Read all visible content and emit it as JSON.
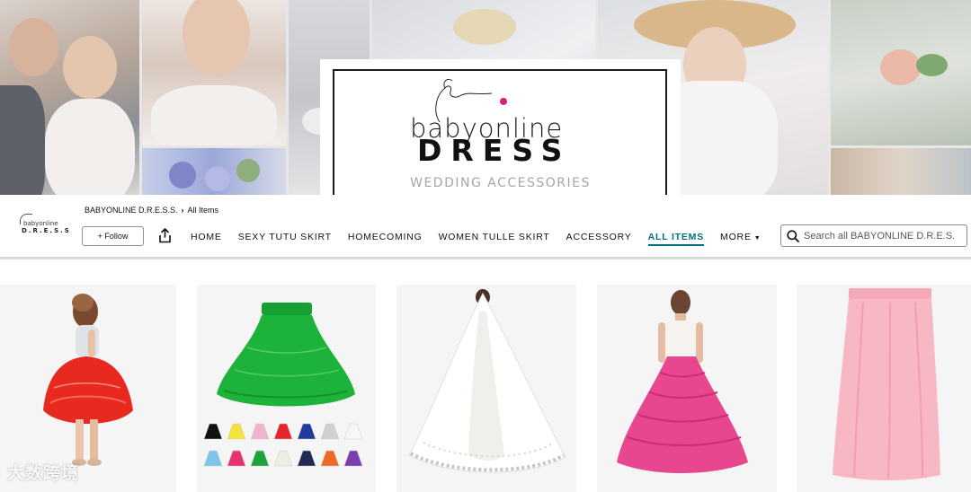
{
  "hero": {
    "brand_line1": "babyonline",
    "brand_line2": "DRESS",
    "tagline": "WEDDING ACCESSORIES"
  },
  "store": {
    "logo_line1": "babyonline",
    "logo_line2": "D.R.E.S.S",
    "breadcrumb": [
      "BABYONLINE D.R.E.S.S.",
      "All Items"
    ],
    "follow_label": "+ Follow",
    "nav": [
      {
        "label": "HOME",
        "active": false
      },
      {
        "label": "SEXY TUTU SKIRT",
        "active": false
      },
      {
        "label": "HOMECOMING",
        "active": false
      },
      {
        "label": "WOMEN TULLE SKIRT",
        "active": false
      },
      {
        "label": "ACCESSORY",
        "active": false
      },
      {
        "label": "ALL ITEMS",
        "active": true
      }
    ],
    "more_label": "MORE",
    "search_placeholder": "Search all BABYONLINE D.R.E.S."
  },
  "products": [
    {
      "name": "red-sequin-tutu-skirt",
      "color": "#e8291f"
    },
    {
      "name": "green-petticoat-skirt",
      "color": "#1db33a"
    },
    {
      "name": "white-lace-bridal-veil",
      "color": "#f4f3f1"
    },
    {
      "name": "pink-hoop-petticoat",
      "color": "#e8468f"
    },
    {
      "name": "pink-tulle-maxi-skirt",
      "color": "#f7b7c3"
    }
  ],
  "swatches": [
    "#111111",
    "#f5e23a",
    "#f0b3d0",
    "#e8242e",
    "#233a9e",
    "#cfd0d4",
    "#f7f7f7",
    "#7ec5ea",
    "#e8336d",
    "#1da43b",
    "#efece1",
    "#1f2a55",
    "#f06a25",
    "#7a3fb0"
  ],
  "watermark": "大数跨境",
  "colors": {
    "accent": "#007185",
    "text": "#0f1111"
  }
}
